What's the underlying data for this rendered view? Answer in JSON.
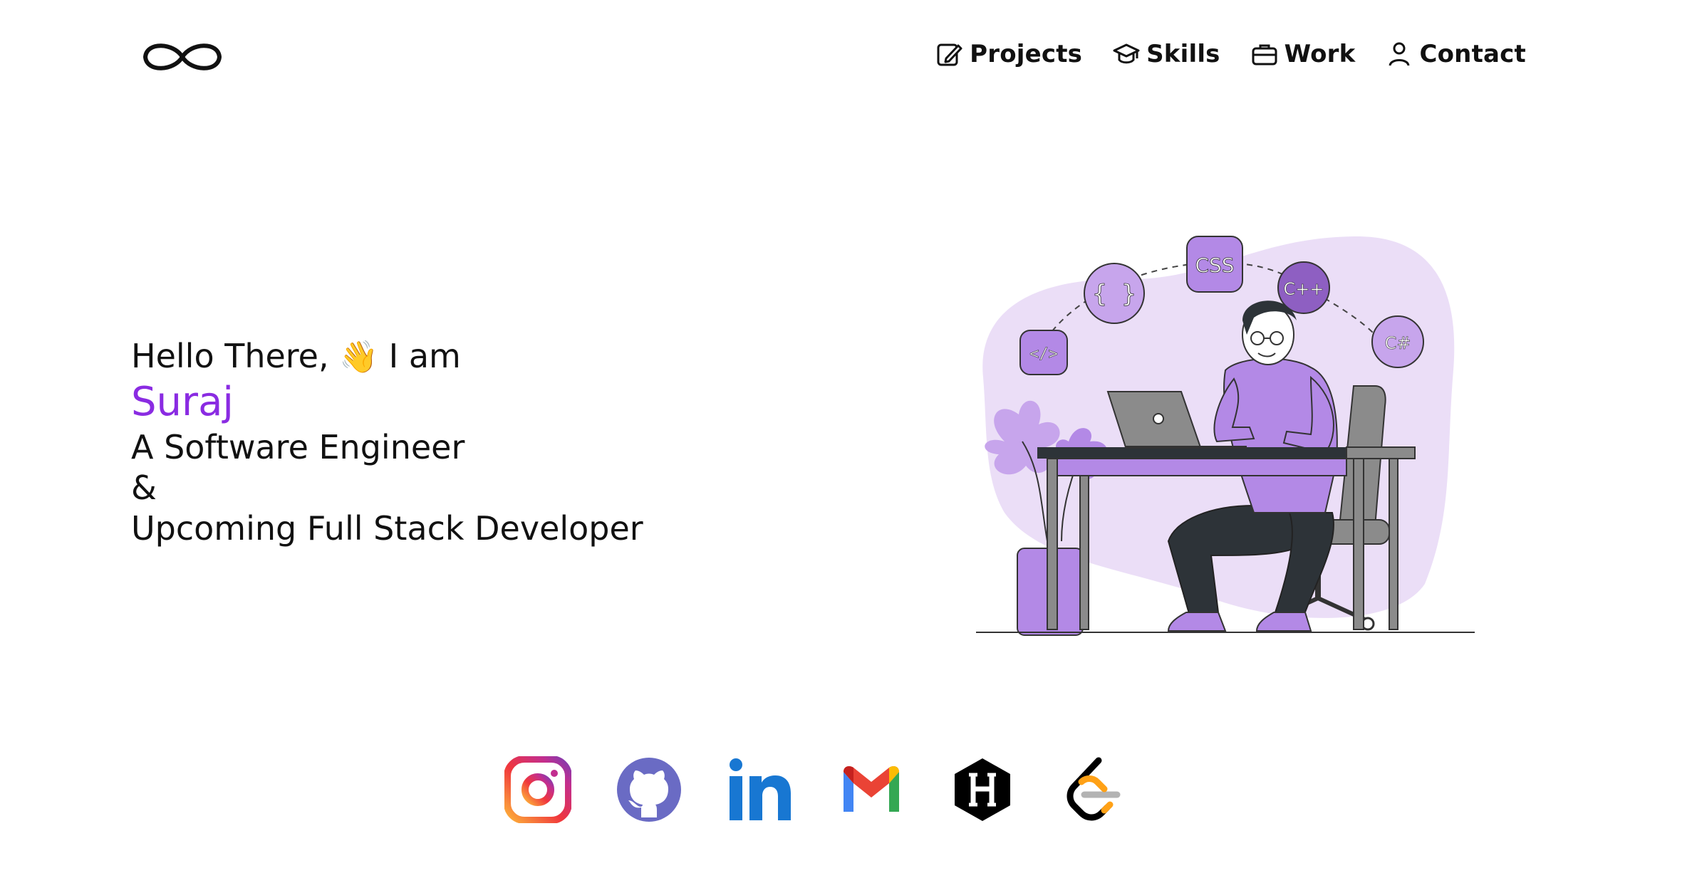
{
  "header": {
    "logo_icon": "infinity-icon",
    "nav": [
      {
        "label": "Projects",
        "icon": "edit-note-icon"
      },
      {
        "label": "Skills",
        "icon": "graduation-cap-icon"
      },
      {
        "label": "Work",
        "icon": "briefcase-icon"
      },
      {
        "label": "Contact",
        "icon": "user-icon"
      }
    ]
  },
  "hero": {
    "greeting": "Hello There, ",
    "wave_emoji": "👋",
    "greeting_suffix": " I am",
    "name": "Suraj",
    "role": "A Software Engineer",
    "ampersand": "&",
    "subtitle": "Upcoming Full Stack Developer",
    "name_color": "#8a2be2"
  },
  "illustration": {
    "badges": [
      "</>",
      "{ }",
      "CSS",
      "C++",
      "C#"
    ],
    "accent": "#b389e6",
    "blob": "#ebdef7"
  },
  "socials": [
    {
      "icon": "instagram-icon"
    },
    {
      "icon": "github-icon"
    },
    {
      "icon": "linkedin-icon"
    },
    {
      "icon": "gmail-icon"
    },
    {
      "icon": "hashnode-icon"
    },
    {
      "icon": "leetcode-icon"
    }
  ]
}
